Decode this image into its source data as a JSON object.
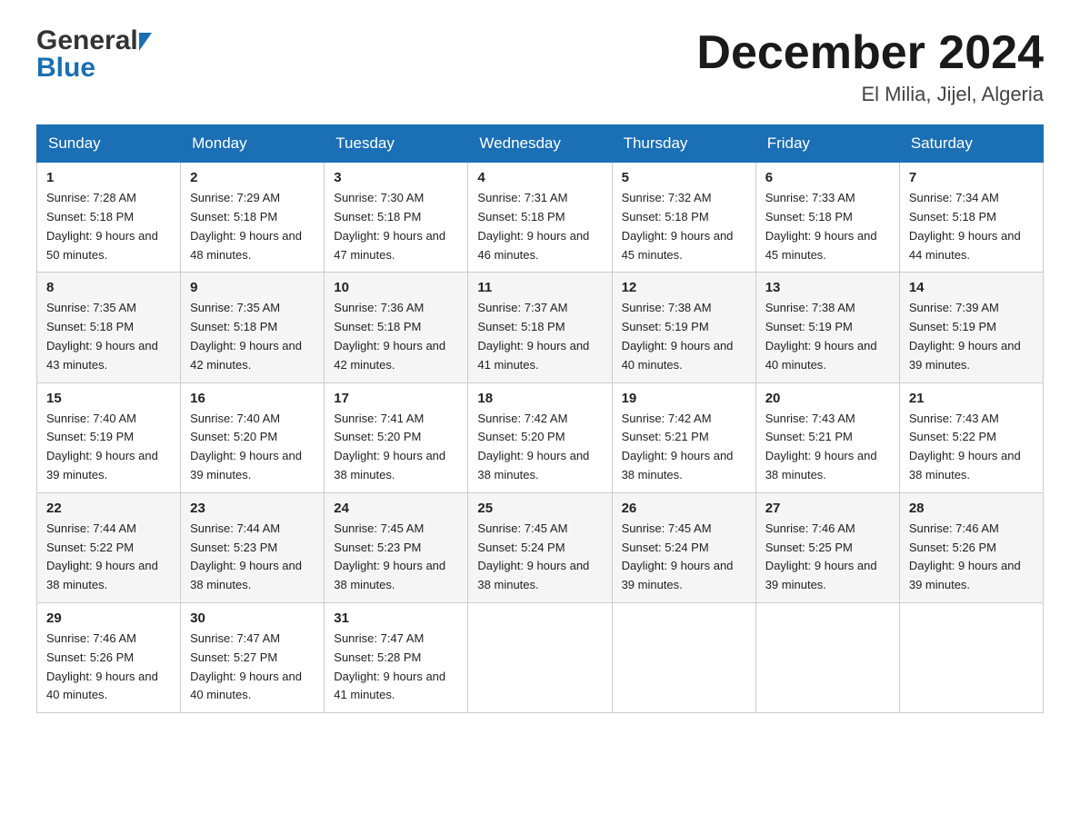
{
  "header": {
    "logo_general": "General",
    "logo_blue": "Blue",
    "month_title": "December 2024",
    "location": "El Milia, Jijel, Algeria"
  },
  "days_of_week": [
    "Sunday",
    "Monday",
    "Tuesday",
    "Wednesday",
    "Thursday",
    "Friday",
    "Saturday"
  ],
  "weeks": [
    [
      {
        "day": "1",
        "sunrise": "7:28 AM",
        "sunset": "5:18 PM",
        "daylight": "9 hours and 50 minutes."
      },
      {
        "day": "2",
        "sunrise": "7:29 AM",
        "sunset": "5:18 PM",
        "daylight": "9 hours and 48 minutes."
      },
      {
        "day": "3",
        "sunrise": "7:30 AM",
        "sunset": "5:18 PM",
        "daylight": "9 hours and 47 minutes."
      },
      {
        "day": "4",
        "sunrise": "7:31 AM",
        "sunset": "5:18 PM",
        "daylight": "9 hours and 46 minutes."
      },
      {
        "day": "5",
        "sunrise": "7:32 AM",
        "sunset": "5:18 PM",
        "daylight": "9 hours and 45 minutes."
      },
      {
        "day": "6",
        "sunrise": "7:33 AM",
        "sunset": "5:18 PM",
        "daylight": "9 hours and 45 minutes."
      },
      {
        "day": "7",
        "sunrise": "7:34 AM",
        "sunset": "5:18 PM",
        "daylight": "9 hours and 44 minutes."
      }
    ],
    [
      {
        "day": "8",
        "sunrise": "7:35 AM",
        "sunset": "5:18 PM",
        "daylight": "9 hours and 43 minutes."
      },
      {
        "day": "9",
        "sunrise": "7:35 AM",
        "sunset": "5:18 PM",
        "daylight": "9 hours and 42 minutes."
      },
      {
        "day": "10",
        "sunrise": "7:36 AM",
        "sunset": "5:18 PM",
        "daylight": "9 hours and 42 minutes."
      },
      {
        "day": "11",
        "sunrise": "7:37 AM",
        "sunset": "5:18 PM",
        "daylight": "9 hours and 41 minutes."
      },
      {
        "day": "12",
        "sunrise": "7:38 AM",
        "sunset": "5:19 PM",
        "daylight": "9 hours and 40 minutes."
      },
      {
        "day": "13",
        "sunrise": "7:38 AM",
        "sunset": "5:19 PM",
        "daylight": "9 hours and 40 minutes."
      },
      {
        "day": "14",
        "sunrise": "7:39 AM",
        "sunset": "5:19 PM",
        "daylight": "9 hours and 39 minutes."
      }
    ],
    [
      {
        "day": "15",
        "sunrise": "7:40 AM",
        "sunset": "5:19 PM",
        "daylight": "9 hours and 39 minutes."
      },
      {
        "day": "16",
        "sunrise": "7:40 AM",
        "sunset": "5:20 PM",
        "daylight": "9 hours and 39 minutes."
      },
      {
        "day": "17",
        "sunrise": "7:41 AM",
        "sunset": "5:20 PM",
        "daylight": "9 hours and 38 minutes."
      },
      {
        "day": "18",
        "sunrise": "7:42 AM",
        "sunset": "5:20 PM",
        "daylight": "9 hours and 38 minutes."
      },
      {
        "day": "19",
        "sunrise": "7:42 AM",
        "sunset": "5:21 PM",
        "daylight": "9 hours and 38 minutes."
      },
      {
        "day": "20",
        "sunrise": "7:43 AM",
        "sunset": "5:21 PM",
        "daylight": "9 hours and 38 minutes."
      },
      {
        "day": "21",
        "sunrise": "7:43 AM",
        "sunset": "5:22 PM",
        "daylight": "9 hours and 38 minutes."
      }
    ],
    [
      {
        "day": "22",
        "sunrise": "7:44 AM",
        "sunset": "5:22 PM",
        "daylight": "9 hours and 38 minutes."
      },
      {
        "day": "23",
        "sunrise": "7:44 AM",
        "sunset": "5:23 PM",
        "daylight": "9 hours and 38 minutes."
      },
      {
        "day": "24",
        "sunrise": "7:45 AM",
        "sunset": "5:23 PM",
        "daylight": "9 hours and 38 minutes."
      },
      {
        "day": "25",
        "sunrise": "7:45 AM",
        "sunset": "5:24 PM",
        "daylight": "9 hours and 38 minutes."
      },
      {
        "day": "26",
        "sunrise": "7:45 AM",
        "sunset": "5:24 PM",
        "daylight": "9 hours and 39 minutes."
      },
      {
        "day": "27",
        "sunrise": "7:46 AM",
        "sunset": "5:25 PM",
        "daylight": "9 hours and 39 minutes."
      },
      {
        "day": "28",
        "sunrise": "7:46 AM",
        "sunset": "5:26 PM",
        "daylight": "9 hours and 39 minutes."
      }
    ],
    [
      {
        "day": "29",
        "sunrise": "7:46 AM",
        "sunset": "5:26 PM",
        "daylight": "9 hours and 40 minutes."
      },
      {
        "day": "30",
        "sunrise": "7:47 AM",
        "sunset": "5:27 PM",
        "daylight": "9 hours and 40 minutes."
      },
      {
        "day": "31",
        "sunrise": "7:47 AM",
        "sunset": "5:28 PM",
        "daylight": "9 hours and 41 minutes."
      },
      null,
      null,
      null,
      null
    ]
  ]
}
